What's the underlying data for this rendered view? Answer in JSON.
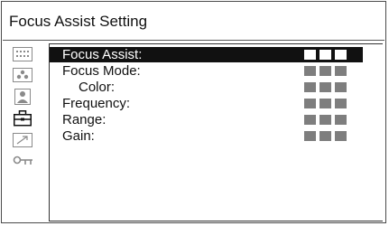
{
  "header": {
    "title": "Focus Assist Setting"
  },
  "sidebar": {
    "icons": [
      "grid-dots-icon",
      "dots-cluster-icon",
      "person-icon",
      "briefcase-icon",
      "diagonal-arrow-icon",
      "key-icon"
    ],
    "selected_icon": "briefcase-icon"
  },
  "menu": {
    "selected_item": "Focus Assist:",
    "items": [
      {
        "label": "Focus Assist:",
        "selected": true,
        "indent": false
      },
      {
        "label": "Focus Mode:",
        "selected": false,
        "indent": false
      },
      {
        "label": "Color:",
        "selected": false,
        "indent": true
      },
      {
        "label": "Frequency:",
        "selected": false,
        "indent": false
      },
      {
        "label": "Range:",
        "selected": false,
        "indent": false
      },
      {
        "label": "Gain:",
        "selected": false,
        "indent": false
      }
    ]
  },
  "colors": {
    "selection_background": "#111111",
    "selection_text": "#ffffff",
    "value_block_inactive": "#7e7e7e",
    "border": "#4a4a4a"
  }
}
